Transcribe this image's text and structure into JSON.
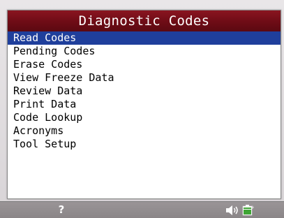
{
  "screen": {
    "title": "Diagnostic Codes",
    "menu": [
      {
        "label": "Read Codes",
        "selected": true
      },
      {
        "label": "Pending Codes",
        "selected": false
      },
      {
        "label": "Erase Codes",
        "selected": false
      },
      {
        "label": "View Freeze Data",
        "selected": false
      },
      {
        "label": "Review Data",
        "selected": false
      },
      {
        "label": "Print Data",
        "selected": false
      },
      {
        "label": "Code Lookup",
        "selected": false
      },
      {
        "label": "Acronyms",
        "selected": false
      },
      {
        "label": "Tool Setup",
        "selected": false
      }
    ]
  },
  "bottom_bar": {
    "help_label": "?",
    "icons": [
      "speaker-icon",
      "battery-icon"
    ]
  },
  "colors": {
    "title_bar": "#6e0c16",
    "selection": "#1f3f9c",
    "bottom_bar": "#8f8a8c",
    "battery_fill": "#3fa535"
  }
}
